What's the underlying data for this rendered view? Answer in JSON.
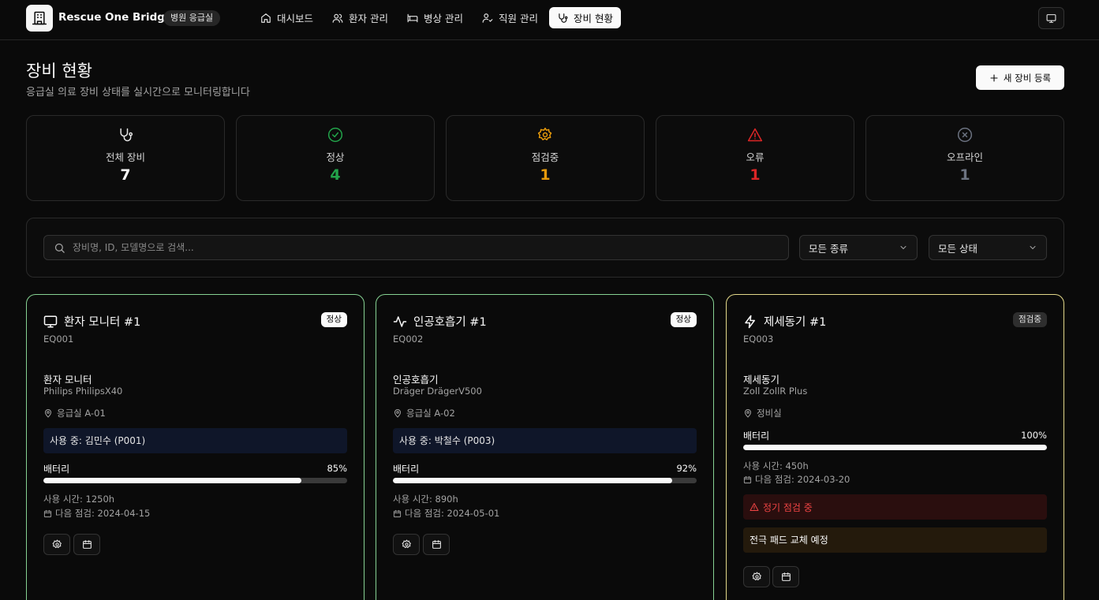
{
  "header": {
    "app_title": "Rescue One Bridge",
    "dept_badge": "병원 응급실",
    "nav": [
      {
        "label": "대시보드",
        "icon": "home-icon",
        "active": false
      },
      {
        "label": "환자 관리",
        "icon": "users-icon",
        "active": false
      },
      {
        "label": "병상 관리",
        "icon": "bed-icon",
        "active": false
      },
      {
        "label": "직원 관리",
        "icon": "user-check-icon",
        "active": false
      },
      {
        "label": "장비 현황",
        "icon": "stethoscope-icon",
        "active": true
      }
    ]
  },
  "page": {
    "title": "장비 현황",
    "subtitle": "응급실 의료 장비 상태를 실시간으로 모니터링합니다",
    "add_button": "새 장비 등록"
  },
  "stats": [
    {
      "label": "전체 장비",
      "value": "7",
      "color": "#fafafa",
      "icon": "stethoscope-icon"
    },
    {
      "label": "정상",
      "value": "4",
      "color": "#22a34a",
      "icon": "check-circle-icon"
    },
    {
      "label": "점검중",
      "value": "1",
      "color": "#e69a0b",
      "icon": "gear-icon"
    },
    {
      "label": "오류",
      "value": "1",
      "color": "#dc2626",
      "icon": "warning-icon"
    },
    {
      "label": "오프라인",
      "value": "1",
      "color": "#6b7280",
      "icon": "x-circle-icon"
    }
  ],
  "filters": {
    "search_placeholder": "장비명, ID, 모델명으로 검색...",
    "type_select": "모든 종류",
    "status_select": "모든 상태"
  },
  "equipment": [
    {
      "name": "환자 모니터 #1",
      "icon": "monitor-icon",
      "status": "정상",
      "id": "EQ001",
      "type": "환자 모니터",
      "model": "Philips PhilipsX40",
      "location": "응급실 A-01",
      "in_use": "사용 중: 김민수 (P001)",
      "battery_label": "배터리",
      "battery_pct": "85%",
      "battery": 85,
      "usage": "사용 시간: 1250h",
      "next_check": "다음 점검: 2024-04-15"
    },
    {
      "name": "인공호흡기 #1",
      "icon": "activity-icon",
      "status": "정상",
      "id": "EQ002",
      "type": "인공호흡기",
      "model": "Dräger DrägerV500",
      "location": "응급실 A-02",
      "in_use": "사용 중: 박철수 (P003)",
      "battery_label": "배터리",
      "battery_pct": "92%",
      "battery": 92,
      "usage": "사용 시간: 890h",
      "next_check": "다음 점검: 2024-05-01"
    },
    {
      "name": "제세동기 #1",
      "icon": "zap-icon",
      "status": "점검중",
      "id": "EQ003",
      "type": "제세동기",
      "model": "Zoll ZollR Plus",
      "location": "정비실",
      "battery_label": "배터리",
      "battery_pct": "100%",
      "battery": 100,
      "usage": "사용 시간: 450h",
      "next_check": "다음 점검: 2024-03-20",
      "alert": "정기 점검 중",
      "note": "전극 패드 교체 예정"
    }
  ]
}
